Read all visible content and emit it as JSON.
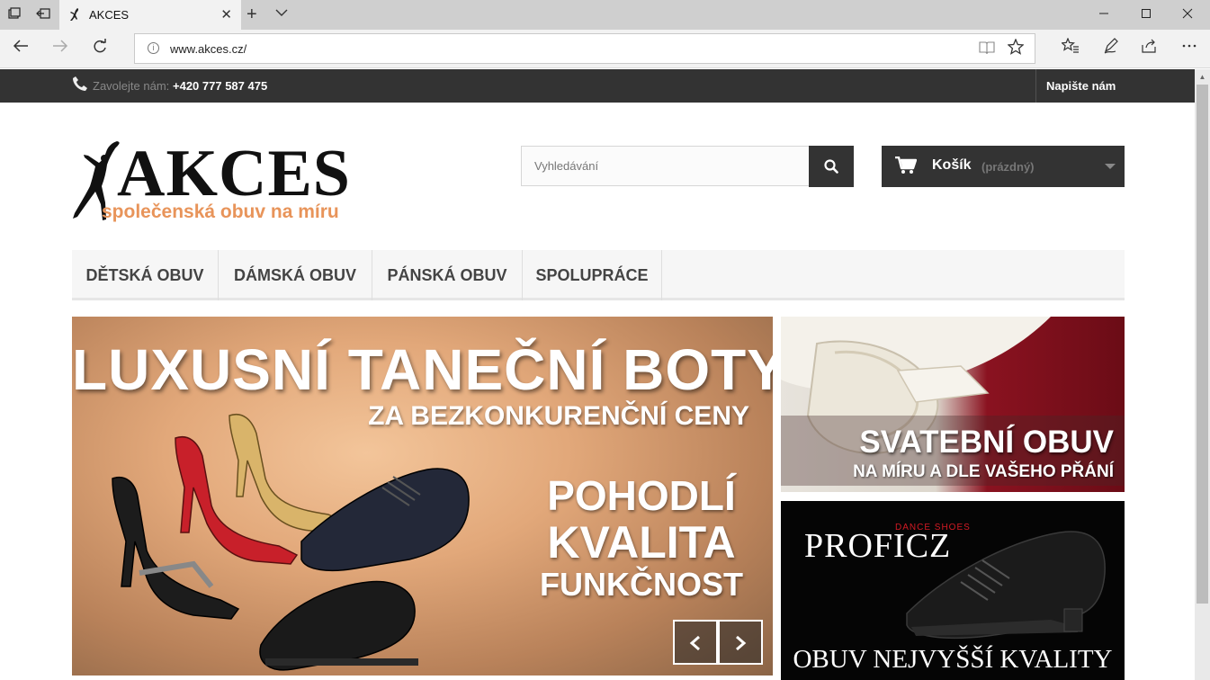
{
  "browser": {
    "tab_title": "AKCES",
    "url": "www.akces.cz/",
    "url_info_icon": "i"
  },
  "topbar": {
    "phone_label": "Zavolejte nám:",
    "phone_number": "+420 777 587 475",
    "contact_link": "Napište nám"
  },
  "header": {
    "logo_text": "AKCES",
    "logo_tagline": "společenská obuv na míru",
    "search_placeholder": "Vyhledávání",
    "cart_label": "Košík",
    "cart_status": "(prázdný)"
  },
  "menu": {
    "items": [
      "DĚTSKÁ OBUV",
      "DÁMSKÁ OBUV",
      "PÁNSKÁ OBUV",
      "SPOLUPRÁCE"
    ]
  },
  "slider": {
    "title": "LUXUSNÍ TANEČNÍ BOTY",
    "subtitle": "ZA BEZKONKURENČNÍ CENY",
    "quality_1": "POHODLÍ",
    "quality_2": "KVALITA",
    "quality_3": "FUNKČNOST"
  },
  "banner_wedding": {
    "title": "SVATEBNÍ OBUV",
    "subtitle": "NA MÍRU A DLE VAŠEHO PŘÁNÍ"
  },
  "banner_proficz": {
    "brand_small": "DANCE SHOES",
    "brand": "PROFICZ",
    "caption": "OBUV NEJVYŠŠÍ KVALITY"
  },
  "colors": {
    "dark_bar": "#333333",
    "logo_accent": "#e8945a",
    "menu_bg": "#f6f6f6"
  }
}
